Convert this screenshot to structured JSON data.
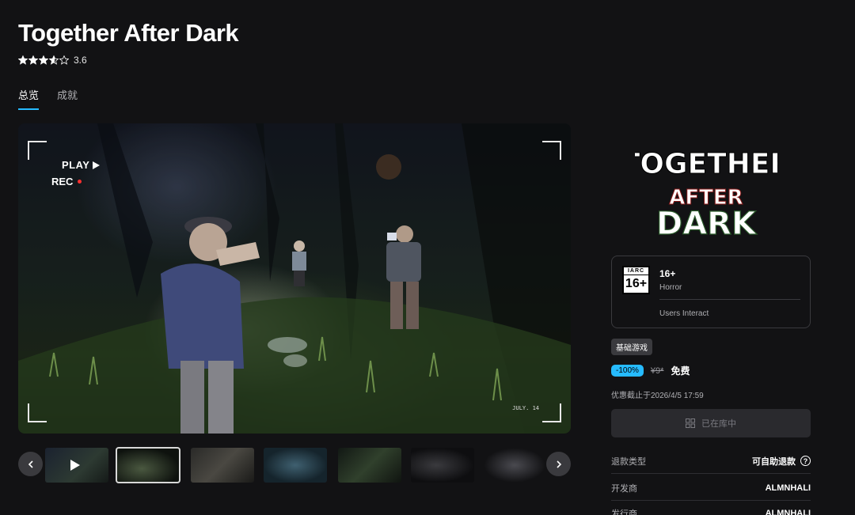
{
  "game": {
    "title": "Together After Dark",
    "rating_value": "3.6",
    "rating_stars": 3.6
  },
  "tabs": [
    {
      "label": "总览",
      "active": true
    },
    {
      "label": "成就",
      "active": false
    }
  ],
  "media": {
    "overlay_play": "PLAY",
    "overlay_rec": "REC",
    "overlay_date": "JULY. 14",
    "thumbnail_count": 7,
    "active_thumbnail": 1
  },
  "logo": {
    "line1": "TOGETHER",
    "line2": "AFTER",
    "line3": "DARK"
  },
  "age_rating": {
    "iarc_label": "IARC",
    "iarc_value": "16+",
    "rating": "16+",
    "genre": "Horror",
    "interaction": "Users Interact"
  },
  "offer": {
    "badge": "基础游戏",
    "discount": "-100%",
    "original_price": "¥9*",
    "final_price": "免费",
    "sale_end": "优惠截止于2026/4/5 17:59",
    "library_button": "已在库中"
  },
  "details": [
    {
      "label": "退款类型",
      "value": "可自助退款",
      "help": true
    },
    {
      "label": "开发商",
      "value": "ALMNHALI"
    },
    {
      "label": "发行商",
      "value": "ALMNHALI"
    }
  ],
  "colors": {
    "background": "#121214",
    "accent": "#26bbff",
    "panel": "#2a2a2e"
  },
  "icons": {
    "play": "play-icon",
    "rec": "record-dot-icon",
    "prev": "chevron-left-icon",
    "next": "chevron-right-icon",
    "library": "grid-icon",
    "help": "question-circle-icon",
    "star": "star-icon"
  }
}
